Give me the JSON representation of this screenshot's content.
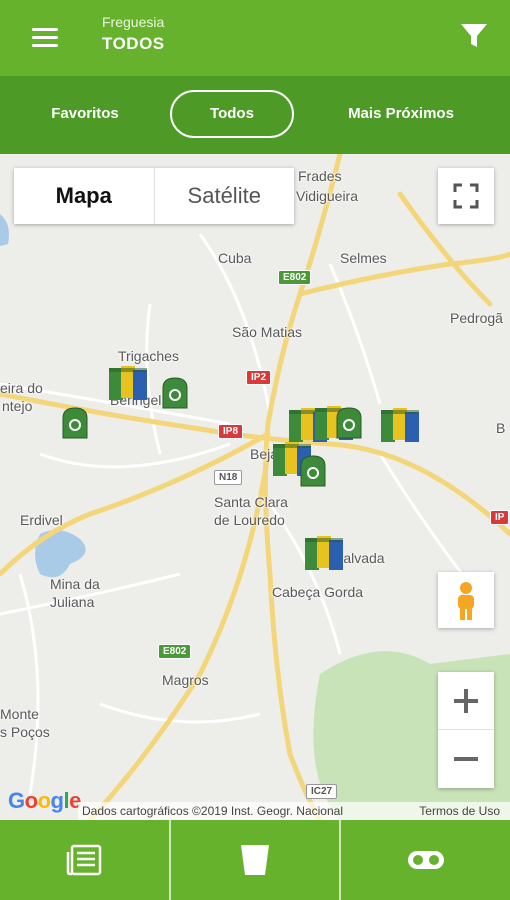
{
  "header": {
    "subtitle": "Freguesia",
    "title": "TODOS",
    "menu_icon": "hamburger-menu-icon",
    "filter_icon": "filter-funnel-icon"
  },
  "tabs": [
    {
      "label": "Favoritos",
      "selected": false
    },
    {
      "label": "Todos",
      "selected": true
    },
    {
      "label": "Mais Próximos",
      "selected": false
    }
  ],
  "map": {
    "map_type": {
      "map_label": "Mapa",
      "satellite_label": "Satélite",
      "selected": "Mapa"
    },
    "places": [
      "Frades",
      "Vidigueira",
      "Cuba",
      "Selmes",
      "Pedrogã",
      "São Matias",
      "Trigaches",
      "Beringel",
      "eira do",
      "ntejo",
      "Beja",
      "Santa Clara",
      "de Louredo",
      "Erdivel",
      "Mina da",
      "Juliana",
      "Salvada",
      "Cabeça Gorda",
      "Magros",
      "Monte",
      "s Poços",
      "B"
    ],
    "roads": [
      "E802",
      "IP2",
      "IP8",
      "N18",
      "E802",
      "IC27",
      "IP"
    ],
    "google_logo": "Google",
    "attribution": "Dados cartográficos ©2019 Inst. Geogr. Nacional",
    "terms": "Termos de Uso",
    "colors": {
      "accent": "#66b22c",
      "accent_dark": "#4d9a26",
      "marker_green": "#3d8a3a",
      "marker_yellow": "#e8c21e",
      "marker_blue": "#2b5fb0"
    }
  },
  "bottom_nav": [
    {
      "icon": "news-list-icon"
    },
    {
      "icon": "cup-icon"
    },
    {
      "icon": "toggle-icon"
    }
  ]
}
